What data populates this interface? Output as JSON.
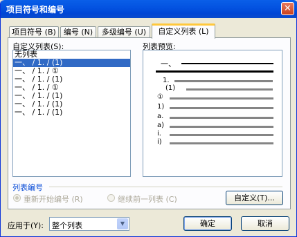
{
  "window": {
    "title": "项目符号和编号",
    "close_symbol": "✕"
  },
  "tabs": [
    {
      "label": "项目符号 (B)"
    },
    {
      "label": "编号 (N)"
    },
    {
      "label": "多级编号 (U)"
    },
    {
      "label": "自定义列表 (L)",
      "active": true
    }
  ],
  "list": {
    "label": "自定义列表(S):",
    "items": [
      "无列表",
      "一、 / 1. / (1)",
      "一、 / 1. / ①",
      "一、 / 1. / (1)",
      "一、 / 1. / ①",
      "一、 / 1. / (1)",
      "一、 / 1. / (1)",
      "一、 / 1. / (1)"
    ],
    "selected_index": 1
  },
  "preview": {
    "label": "列表预览:",
    "markers": [
      "一、",
      "1.",
      "(1)",
      "①",
      "1)",
      "a.",
      "a)",
      "i.",
      "i)"
    ]
  },
  "numbering": {
    "section_label": "列表编号",
    "restart_label": "重新开始编号 (R)",
    "continue_label": "继续前一列表 (C)",
    "customize_button": "自定义(T)..."
  },
  "footer": {
    "apply_label": "应用于(Y):",
    "apply_value": "整个列表",
    "ok_button": "确定",
    "cancel_button": "取消"
  },
  "colors": {
    "titlebar": "#0054e3",
    "selection": "#316ac5",
    "tab_highlight": "#ffc83c",
    "section_text": "#0046d5"
  }
}
